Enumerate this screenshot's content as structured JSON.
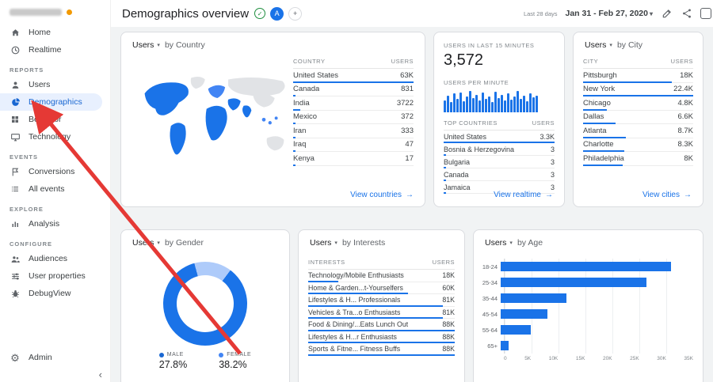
{
  "colors": {
    "accent": "#1a73e8",
    "selected_nav": "#1967d2",
    "annotation_arrow": "#e53935",
    "male_dot": "#1967d2",
    "female_dot": "#4285f4"
  },
  "sidebar": {
    "sections": {
      "reports": "REPORTS",
      "events": "EVENTS",
      "explore": "EXPLORE",
      "configure": "CONFIGURE"
    },
    "items": [
      {
        "label": "Home"
      },
      {
        "label": "Realtime"
      },
      {
        "label": "Users"
      },
      {
        "label": "Demographics"
      },
      {
        "label": "Behavior"
      },
      {
        "label": "Technology"
      },
      {
        "label": "Conversions"
      },
      {
        "label": "All events"
      },
      {
        "label": "Analysis"
      },
      {
        "label": "Audiences"
      },
      {
        "label": "User properties"
      },
      {
        "label": "DebugView"
      }
    ],
    "admin_label": "Admin",
    "collapse_glyph": "‹"
  },
  "header": {
    "title": "Demographics overview",
    "verified_glyph": "✓",
    "segment_chip": "A",
    "add_chip": "+",
    "date_label": "Last 28 days",
    "date_range": "Jan 31 - Feb 27, 2020",
    "date_caret": "▾"
  },
  "cards": {
    "country": {
      "title_users": "Users",
      "caret": "▾",
      "title_by": "by Country",
      "col_name": "COUNTRY",
      "col_users": "USERS",
      "rows": [
        {
          "name": "United States",
          "users": "63K",
          "value": 63000
        },
        {
          "name": "Canada",
          "users": "831",
          "value": 831
        },
        {
          "name": "India",
          "users": "3722",
          "value": 3722
        },
        {
          "name": "Mexico",
          "users": "372",
          "value": 372
        },
        {
          "name": "Iran",
          "users": "333",
          "value": 333
        },
        {
          "name": "Iraq",
          "users": "47",
          "value": 47
        },
        {
          "name": "Kenya",
          "users": "17",
          "value": 17
        }
      ],
      "link": "View countries",
      "link_arrow": "→"
    },
    "realtime": {
      "label": "USERS IN LAST 15 MINUTES",
      "big_number": "3,572",
      "per_minute_label": "USERS PER MINUTE",
      "spark": [
        55,
        75,
        45,
        85,
        60,
        90,
        50,
        70,
        95,
        65,
        80,
        55,
        88,
        60,
        72,
        48,
        92,
        66,
        78,
        54,
        84,
        58,
        70,
        96,
        62,
        76,
        50,
        86,
        68,
        74
      ],
      "top_countries_label": "TOP COUNTRIES",
      "col_users": "USERS",
      "rows": [
        {
          "name": "United States",
          "users": "3.3K",
          "value": 3300
        },
        {
          "name": "Bosnia & Herzegovina",
          "users": "3",
          "value": 3
        },
        {
          "name": "Bulgaria",
          "users": "3",
          "value": 3
        },
        {
          "name": "Canada",
          "users": "3",
          "value": 3
        },
        {
          "name": "Jamaica",
          "users": "3",
          "value": 3
        }
      ],
      "link": "View realtime",
      "link_arrow": "→"
    },
    "city": {
      "title_users": "Users",
      "caret": "▾",
      "title_by": "by City",
      "col_name": "CITY",
      "col_users": "USERS",
      "rows": [
        {
          "name": "Pittsburgh",
          "users": "18K",
          "value": 18000
        },
        {
          "name": "New York",
          "users": "22.4K",
          "value": 22400
        },
        {
          "name": "Chicago",
          "users": "4.8K",
          "value": 4800
        },
        {
          "name": "Dallas",
          "users": "6.6K",
          "value": 6600
        },
        {
          "name": "Atlanta",
          "users": "8.7K",
          "value": 8700
        },
        {
          "name": "Charlotte",
          "users": "8.3K",
          "value": 8300
        },
        {
          "name": "Philadelphia",
          "users": "8K",
          "value": 8000
        }
      ],
      "link": "View cities",
      "link_arrow": "→"
    },
    "gender": {
      "title_users": "Users",
      "caret": "▾",
      "title_by": "by Gender",
      "legend": [
        {
          "label": "MALE",
          "pct": "27.8%"
        },
        {
          "label": "FEMALE",
          "pct": "38.2%"
        }
      ]
    },
    "interests": {
      "title_users": "Users",
      "caret": "▾",
      "title_by": "by Interests",
      "col_name": "INTERESTS",
      "col_users": "USERS",
      "rows": [
        {
          "name": "Technology/Mobile Enthusiasts",
          "users": "18K",
          "value": 18000
        },
        {
          "name": "Home & Garden...t-Yourselfers",
          "users": "60K",
          "value": 60000
        },
        {
          "name": "Lifestyles & H... Professionals",
          "users": "81K",
          "value": 81000
        },
        {
          "name": "Vehicles & Tra...o Enthusiasts",
          "users": "81K",
          "value": 81000
        },
        {
          "name": "Food & Dining/...Eats Lunch Out",
          "users": "88K",
          "value": 88000
        },
        {
          "name": "Lifestyles & H...r Enthusiasts",
          "users": "88K",
          "value": 88000
        },
        {
          "name": "Sports & Fitne... Fitness Buffs",
          "users": "88K",
          "value": 88000
        }
      ]
    },
    "age": {
      "title_users": "Users",
      "caret": "▾",
      "title_by": "by Age",
      "rows": [
        {
          "label": "18-24",
          "value": 31000
        },
        {
          "label": "25-34",
          "value": 26500
        },
        {
          "label": "35-44",
          "value": 12000
        },
        {
          "label": "45-54",
          "value": 8500
        },
        {
          "label": "55-64",
          "value": 5500
        },
        {
          "label": "65+",
          "value": 1500
        }
      ],
      "ticks": [
        "0",
        "5K",
        "10K",
        "15K",
        "20K",
        "25K",
        "30K",
        "35K"
      ]
    }
  },
  "chart_data": [
    {
      "type": "table",
      "title": "Users by Country",
      "columns": [
        "COUNTRY",
        "USERS"
      ],
      "rows": [
        [
          "United States",
          63000
        ],
        [
          "Canada",
          831
        ],
        [
          "India",
          3722
        ],
        [
          "Mexico",
          372
        ],
        [
          "Iran",
          333
        ],
        [
          "Iraq",
          47
        ],
        [
          "Kenya",
          17
        ]
      ]
    },
    {
      "type": "bar",
      "title": "Users per minute (last 15 minutes)",
      "total": 3572,
      "values": [
        55,
        75,
        45,
        85,
        60,
        90,
        50,
        70,
        95,
        65,
        80,
        55,
        88,
        60,
        72,
        48,
        92,
        66,
        78,
        54,
        84,
        58,
        70,
        96,
        62,
        76,
        50,
        86,
        68,
        74
      ]
    },
    {
      "type": "table",
      "title": "Users by City",
      "columns": [
        "CITY",
        "USERS"
      ],
      "rows": [
        [
          "Pittsburgh",
          18000
        ],
        [
          "New York",
          22400
        ],
        [
          "Chicago",
          4800
        ],
        [
          "Dallas",
          6600
        ],
        [
          "Atlanta",
          8700
        ],
        [
          "Charlotte",
          8300
        ],
        [
          "Philadelphia",
          8000
        ]
      ]
    },
    {
      "type": "pie",
      "title": "Users by Gender",
      "labels": [
        "MALE",
        "FEMALE"
      ],
      "values": [
        27.8,
        38.2
      ]
    },
    {
      "type": "table",
      "title": "Users by Interests",
      "columns": [
        "INTERESTS",
        "USERS"
      ],
      "rows": [
        [
          "Technology/Mobile Enthusiasts",
          18000
        ],
        [
          "Home & Garden...t-Yourselfers",
          60000
        ],
        [
          "Lifestyles & H... Professionals",
          81000
        ],
        [
          "Vehicles & Tra...o Enthusiasts",
          81000
        ],
        [
          "Food & Dining/...Eats Lunch Out",
          88000
        ],
        [
          "Lifestyles & H...r Enthusiasts",
          88000
        ],
        [
          "Sports & Fitne... Fitness Buffs",
          88000
        ]
      ]
    },
    {
      "type": "bar",
      "title": "Users by Age",
      "orientation": "horizontal",
      "categories": [
        "18-24",
        "25-34",
        "35-44",
        "45-54",
        "55-64",
        "65+"
      ],
      "values": [
        31000,
        26500,
        12000,
        8500,
        5500,
        1500
      ],
      "xlim": [
        0,
        35000
      ]
    }
  ]
}
